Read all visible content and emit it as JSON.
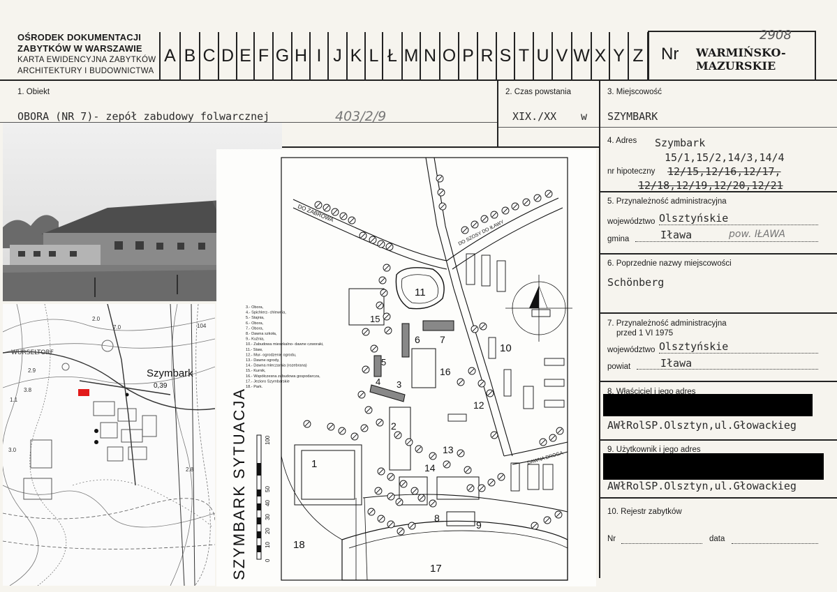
{
  "header": {
    "org_line1": "OŚRODEK DOKUMENTACJI",
    "org_line2": "ZABYTKÓW W WARSZAWIE",
    "org_line3": "KARTA EWIDENCYJNA ZABYTKÓW",
    "org_line4": "ARCHITEKTURY I BUDOWNICTWA",
    "letters": [
      "A",
      "B",
      "C",
      "D",
      "E",
      "F",
      "G",
      "H",
      "I",
      "J",
      "K",
      "L",
      "Ł",
      "M",
      "N",
      "O",
      "P",
      "R",
      "S",
      "T",
      "U",
      "V",
      "W",
      "X",
      "Y",
      "Z"
    ],
    "nr_label": "Nr",
    "region_line1": "WARMIŃSKO-",
    "region_line2": "MAZURSKIE",
    "stamp_number": "2908"
  },
  "obiekt": {
    "label": "1. Obiekt",
    "value": "OBORA (NR 7)- zepół zabudowy folwarcznej",
    "handwritten": "403/2/9"
  },
  "czas": {
    "label": "2. Czas powstania",
    "value": "XIX./XX",
    "suffix": "w"
  },
  "miejscowosc": {
    "label": "3. Miejscowość",
    "value": "SZYMBARK"
  },
  "adres": {
    "label": "4. Adres",
    "value": "Szymbark",
    "line2": "15/1,15/2,14/3,14/4",
    "hip_label": "nr hipoteczny",
    "hip_line1": "12/15,12/16,12/17,",
    "hip_line2": "12/18,12/19,12/20,12/21"
  },
  "przynaleznosc": {
    "label": "5. Przynależność administracyjna",
    "woj_label": "województwo",
    "woj_value": "Olsztyńskie",
    "gmina_label": "gmina",
    "gmina_value": "Iława",
    "gmina_hand": "pow. IŁAWA"
  },
  "poprzednie": {
    "label": "6. Poprzednie nazwy miejscowości",
    "value": "Schönberg"
  },
  "przed1975": {
    "label": "7. Przynależność administracyjna",
    "label2": "przed 1 VI 1975",
    "woj_label": "województwo",
    "woj_value": "Olsztyńskie",
    "powiat_label": "powiat",
    "powiat_value": "Iława"
  },
  "wlasciciel": {
    "label": "8. Właściciel i jego adres",
    "value": "AWłRolSP.Olsztyn,ul.Głowackieg"
  },
  "uzytkownik": {
    "label": "9. Użytkownik i jego adres",
    "value": "AWłRolSP.Olsztyn,ul.Głowackieg"
  },
  "rejestr": {
    "label": "10. Rejestr zabytków",
    "nr_label": "Nr",
    "data_label": "data"
  },
  "topo_map": {
    "label_town": "Szymbark",
    "label_elev": "0,39",
    "label_ul": "WURSELTORF",
    "spot_values": [
      "2.0",
      "7.0",
      "104",
      "2.9",
      "3.8",
      "1.1",
      "3.0",
      "2.8"
    ]
  },
  "site_plan": {
    "vertical_title": "SZYMBARK  SYTUACJA",
    "road_zabrowo": "DO ZABROWA",
    "road_szosa": "DO SZOSY DO IŁAWY",
    "road_dawna": "DAWNA DROGA",
    "scale_ticks": [
      "0",
      "10",
      "20",
      "30",
      "40",
      "50",
      "100"
    ],
    "legend": [
      "3.- Obora,",
      "4.- Spichlerz- chlewnia,",
      "5.- Stajnia,",
      "6.- Obora,",
      "7.- Obora,",
      "8.- Dawna szkoła,",
      "9.- Kuźnia,",
      "10.- Zabudowa mieszkalno- dawne czworaki,",
      "11.- Staw,",
      "12.- Mur- ogrodzenie ogrodu,",
      "13.- Dawne ogrody,",
      "14.- Dawna mleczarnia (rozebrana)",
      "15.- Kurnik,",
      "16.- Współczesna zabudowa gospodarcza,",
      "17.- Jezioro Szymbarskie",
      "18.- Park."
    ],
    "numbers": [
      "1",
      "2",
      "3",
      "4",
      "5",
      "6",
      "7",
      "8",
      "9",
      "10",
      "11",
      "12",
      "13",
      "14",
      "15",
      "16",
      "17",
      "18"
    ]
  },
  "colors": {
    "paper": "#f6f4ee",
    "ink": "#222222",
    "highlight": "#e21a1a"
  }
}
